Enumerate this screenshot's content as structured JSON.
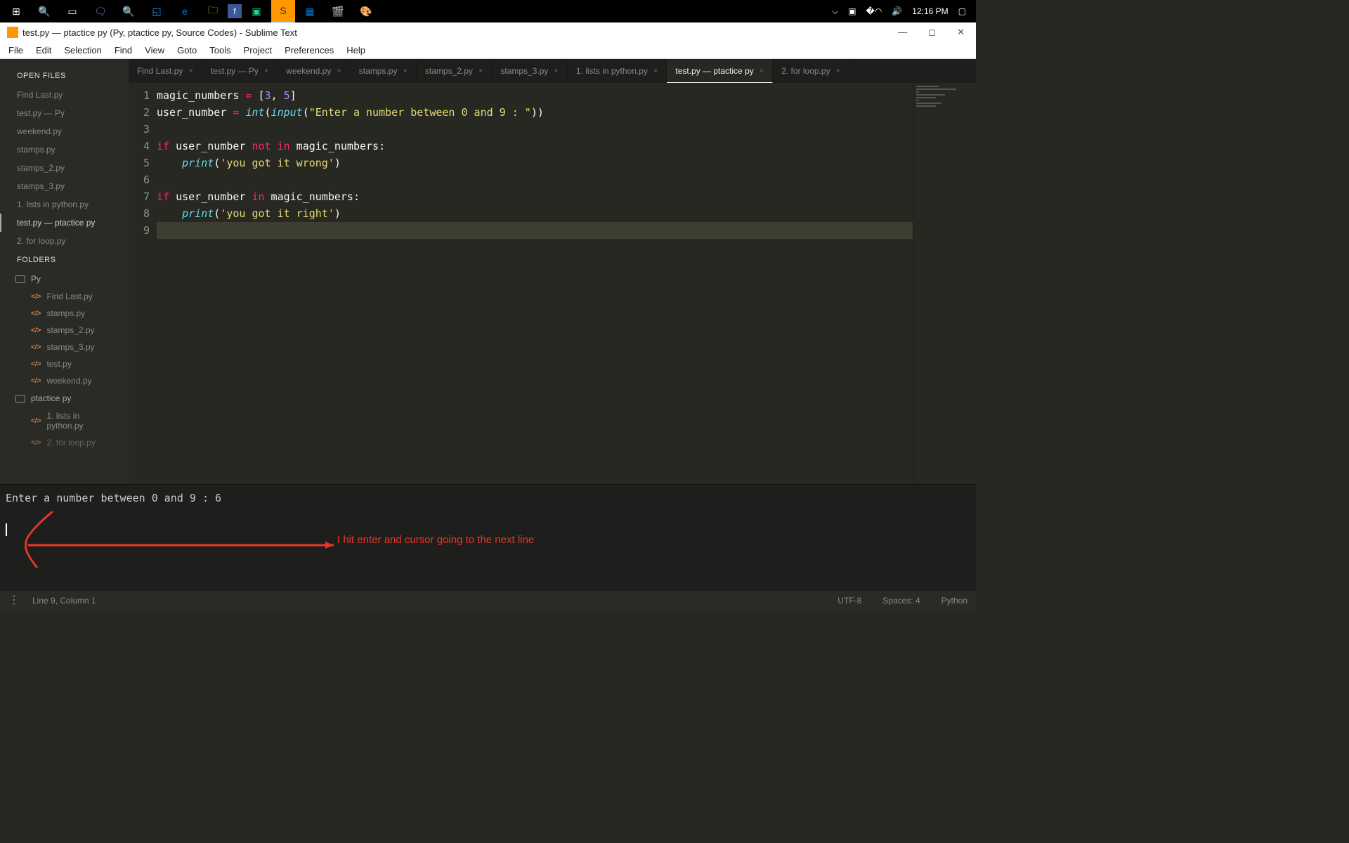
{
  "taskbar": {
    "time": "12:16 PM",
    "icons": [
      "windows",
      "search",
      "taskview",
      "discord",
      "search2",
      "share",
      "edge",
      "explorer",
      "facebook",
      "pycharm",
      "sublime",
      "store",
      "movies",
      "paint"
    ]
  },
  "window": {
    "title": "test.py — ptactice py (Py, ptactice py, Source Codes) - Sublime Text"
  },
  "menu": [
    "File",
    "Edit",
    "Selection",
    "Find",
    "View",
    "Goto",
    "Tools",
    "Project",
    "Preferences",
    "Help"
  ],
  "sidebar": {
    "open_label": "OPEN FILES",
    "open_files": [
      "Find Last.py",
      "test.py — Py",
      "weekend.py",
      "stamps.py",
      "stamps_2.py",
      "stamps_3.py",
      "1. lists in python.py",
      "test.py — ptactice py",
      "2. for loop.py"
    ],
    "active_open": 7,
    "folders_label": "FOLDERS",
    "folders": [
      {
        "name": "Py",
        "files": [
          "Find Last.py",
          "stamps.py",
          "stamps_2.py",
          "stamps_3.py",
          "test.py",
          "weekend.py"
        ]
      },
      {
        "name": "ptactice py",
        "files": [
          "1. lists in python.py",
          "2. for loop.py"
        ]
      }
    ]
  },
  "tabs": [
    {
      "label": "Find Last.py"
    },
    {
      "label": "test.py — Py"
    },
    {
      "label": "weekend.py"
    },
    {
      "label": "stamps.py"
    },
    {
      "label": "stamps_2.py"
    },
    {
      "label": "stamps_3.py"
    },
    {
      "label": "1. lists in python.py"
    },
    {
      "label": "test.py — ptactice py",
      "active": true
    },
    {
      "label": "2. for loop.py"
    }
  ],
  "code": {
    "l1_a": "magic_numbers ",
    "l1_eq": "=",
    "l1_b": " [",
    "l1_n1": "3",
    "l1_c": ", ",
    "l1_n2": "5",
    "l1_d": "]",
    "l2_a": "user_number ",
    "l2_eq": "=",
    "l2_b": " ",
    "l2_int": "int",
    "l2_c": "(",
    "l2_input": "input",
    "l2_d": "(",
    "l2_str": "\"Enter a number between 0 and 9 : \"",
    "l2_e": "))",
    "l4_if": "if",
    "l4_a": " user_number ",
    "l4_not": "not",
    "l4_sp": " ",
    "l4_in": "in",
    "l4_b": " magic_numbers:",
    "l5_print": "print",
    "l5_a": "(",
    "l5_str": "'you got it wrong'",
    "l5_b": ")",
    "l7_if": "if",
    "l7_a": " user_number ",
    "l7_in": "in",
    "l7_b": " magic_numbers:",
    "l8_print": "print",
    "l8_a": "(",
    "l8_str": "'you got it right'",
    "l8_b": ")",
    "line_numbers": [
      "1",
      "2",
      "3",
      "4",
      "5",
      "6",
      "7",
      "8",
      "9"
    ]
  },
  "console": {
    "line1": "Enter a number between 0 and 9 : 6",
    "annotation": "I hit enter and cursor going to the next line"
  },
  "status": {
    "pos": "Line 9, Column 1",
    "encoding": "UTF-8",
    "indent": "Spaces: 4",
    "lang": "Python"
  }
}
